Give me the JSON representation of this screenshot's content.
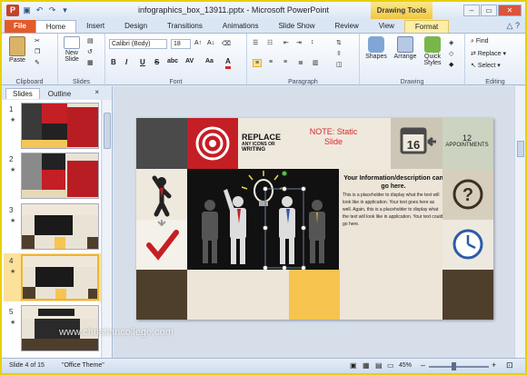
{
  "window": {
    "title": "infographics_box_13911.pptx - Microsoft PowerPoint",
    "context_tab": "Drawing Tools",
    "app_icon": "P"
  },
  "tabs": [
    "File",
    "Home",
    "Insert",
    "Design",
    "Transitions",
    "Animations",
    "Slide Show",
    "Review",
    "View",
    "Format"
  ],
  "ribbon": {
    "clipboard": {
      "label": "Clipboard",
      "paste": "Paste"
    },
    "slides": {
      "label": "Slides",
      "new_slide": "New Slide"
    },
    "font": {
      "label": "Font",
      "family": "Calibri (Body)",
      "size": "18",
      "bold": "B",
      "italic": "I",
      "underline": "U",
      "strike": "S",
      "shadow": "abc",
      "spacing": "AV",
      "case": "Aa",
      "color": "A"
    },
    "paragraph": {
      "label": "Paragraph"
    },
    "drawing": {
      "label": "Drawing",
      "shapes": "Shapes",
      "arrange": "Arrange",
      "quick_styles": "Quick Styles"
    },
    "editing": {
      "label": "Editing",
      "find": "Find",
      "replace": "Replace",
      "select": "Select"
    }
  },
  "pane": {
    "tab_slides": "Slides",
    "tab_outline": "Outline",
    "close": "×",
    "slide_numbers": [
      "1",
      "2",
      "3",
      "4",
      "5"
    ],
    "star": "★"
  },
  "slide": {
    "note": "NOTE: Static Slide",
    "replace_big": "REPLACE",
    "replace_s1": "ANY ICONS OR",
    "replace_s2": "WRITING",
    "calendar_day": "16",
    "appointments_count": "12",
    "appointments_label": "APPOINTMENTS",
    "info_title": "Your Information/description can go here.",
    "info_body": "This is a placeholder to display what the text will look like in application. Your text goes here as well. Again, this is a placeholder to display what the text will look like in application. Your text could go here.",
    "question": "?"
  },
  "status": {
    "slide_of": "Slide 4 of 15",
    "theme": "\"Office Theme\"",
    "zoom": "45%",
    "zoom_value": 45
  },
  "watermark": "www.christiancollege.com",
  "colors": {
    "accent_red": "#c41f25",
    "file_tab": "#e35b2a",
    "context": "#f0c640",
    "selection": "#f0b430"
  }
}
